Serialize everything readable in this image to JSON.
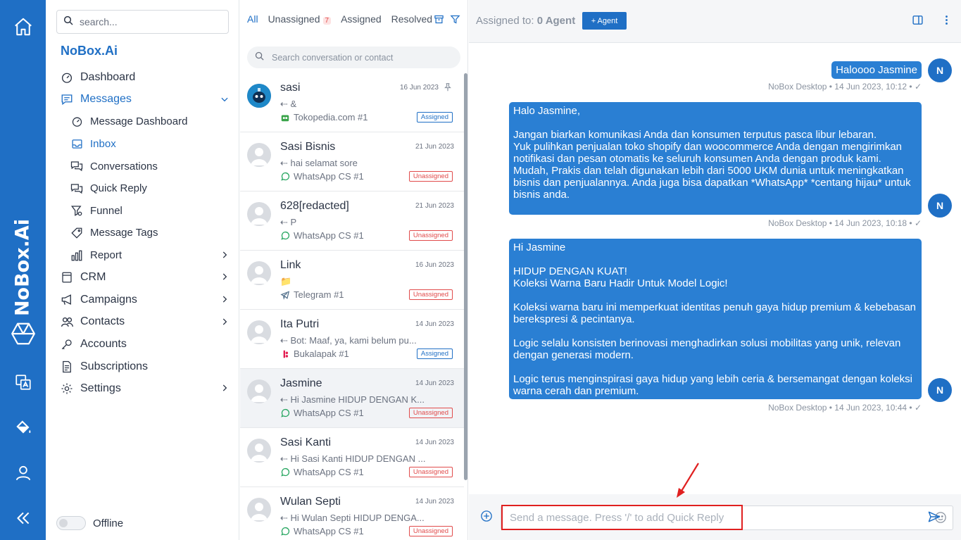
{
  "rail": {
    "brand_vertical": "NoBox.Ai",
    "icons": [
      "home-icon",
      "translate-icon",
      "paint-bucket-icon",
      "user-icon",
      "collapse-icon"
    ]
  },
  "sidebar": {
    "search_placeholder": "search...",
    "brand": "NoBox.Ai",
    "items": [
      {
        "label": "Dashboard",
        "icon": "gauge-icon"
      },
      {
        "label": "Messages",
        "icon": "message-icon",
        "active": true,
        "expanded": true
      },
      {
        "label": "Message Dashboard",
        "icon": "gauge-icon",
        "sub": true
      },
      {
        "label": "Inbox",
        "icon": "inbox-icon",
        "sub": true,
        "active": true
      },
      {
        "label": "Conversations",
        "icon": "conversations-icon",
        "sub": true
      },
      {
        "label": "Quick Reply",
        "icon": "quick-reply-icon",
        "sub": true
      },
      {
        "label": "Funnel",
        "icon": "funnel-icon",
        "sub": true
      },
      {
        "label": "Message Tags",
        "icon": "tag-icon",
        "sub": true
      },
      {
        "label": "Report",
        "icon": "report-icon",
        "sub": true,
        "has_children": true
      },
      {
        "label": "CRM",
        "icon": "crm-icon",
        "has_children": true
      },
      {
        "label": "Campaigns",
        "icon": "megaphone-icon",
        "has_children": true
      },
      {
        "label": "Contacts",
        "icon": "contacts-icon",
        "has_children": true
      },
      {
        "label": "Accounts",
        "icon": "key-icon"
      },
      {
        "label": "Subscriptions",
        "icon": "document-icon"
      },
      {
        "label": "Settings",
        "icon": "gear-icon",
        "has_children": true
      }
    ],
    "status_label": "Offline"
  },
  "list": {
    "tabs": [
      {
        "label": "All",
        "active": true
      },
      {
        "label": "Unassigned",
        "badge": "7"
      },
      {
        "label": "Assigned"
      },
      {
        "label": "Resolved"
      }
    ],
    "search_placeholder": "Search conversation or contact",
    "conversations": [
      {
        "name": "sasi",
        "date": "16 Jun 2023",
        "preview": "&",
        "source": "Tokopedia.com #1",
        "source_icon": "tokopedia-icon",
        "status": "Assigned",
        "pinned": true,
        "avatar": "robot"
      },
      {
        "name": "Sasi Bisnis",
        "date": "21 Jun 2023",
        "preview": "hai selamat sore",
        "source": "WhatsApp CS #1",
        "source_icon": "whatsapp-icon",
        "status": "Unassigned"
      },
      {
        "name": "628[redacted]",
        "date": "21 Jun 2023",
        "preview": "P",
        "source": "WhatsApp CS #1",
        "source_icon": "whatsapp-icon",
        "status": "Unassigned"
      },
      {
        "name": "Link",
        "date": "16 Jun 2023",
        "preview": "📁",
        "source": "Telegram #1",
        "source_icon": "telegram-icon",
        "status": "Unassigned"
      },
      {
        "name": "Ita Putri",
        "date": "14 Jun 2023",
        "preview": "Bot: Maaf, ya, kami belum pu...",
        "source": "Bukalapak #1",
        "source_icon": "bukalapak-icon",
        "status": "Assigned"
      },
      {
        "name": "Jasmine",
        "date": "14 Jun 2023",
        "preview": "Hi Jasmine HIDUP DENGAN K...",
        "source": "WhatsApp CS #1",
        "source_icon": "whatsapp-icon",
        "status": "Unassigned",
        "selected": true
      },
      {
        "name": "Sasi Kanti",
        "date": "14 Jun 2023",
        "preview": "Hi Sasi Kanti HIDUP DENGAN ...",
        "source": "WhatsApp CS #1",
        "source_icon": "whatsapp-icon",
        "status": "Unassigned"
      },
      {
        "name": "Wulan Septi",
        "date": "14 Jun 2023",
        "preview": "Hi Wulan Septi HIDUP DENGA...",
        "source": "WhatsApp CS #1",
        "source_icon": "whatsapp-icon",
        "status": "Unassigned"
      }
    ]
  },
  "chat": {
    "assigned_prefix": "Assigned to:",
    "assigned_value": "0 Agent",
    "agent_button": "+ Agent",
    "messages": [
      {
        "text": "Haloooo Jasmine",
        "meta": "NoBox Desktop • 14 Jun 2023, 10:12 •",
        "avatar": "N"
      },
      {
        "text": "Halo Jasmine,\n\nJangan biarkan komunikasi Anda dan konsumen terputus pasca libur lebaran.\nYuk pulihkan penjualan toko shopify dan woocommerce Anda dengan mengirimkan notifikasi dan pesan otomatis ke seluruh konsumen Anda dengan produk kami.\nMudah, Prakis dan telah digunakan lebih dari 5000 UKM dunia untuk meningkatkan bisnis dan penjualannya. Anda juga bisa dapatkan *WhatsApp* *centang hijau* untuk bisnis anda.",
        "meta": "NoBox Desktop • 14 Jun 2023, 10:18 •",
        "avatar": "N"
      },
      {
        "text": "Hi Jasmine\n\nHIDUP DENGAN KUAT!\nKoleksi Warna Baru Hadir Untuk Model Logic!\n\nKoleksi warna baru ini memperkuat identitas penuh gaya hidup premium & kebebasan berekspresi & pecintanya.\n\nLogic selalu konsisten berinovasi menghadirkan solusi mobilitas yang unik, relevan dengan generasi modern.\n\nLogic terus menginspirasi gaya hidup yang lebih ceria & bersemangat dengan koleksi warna cerah dan premium.",
        "meta": "NoBox Desktop • 14 Jun 2023, 10:44 •",
        "avatar": "N"
      }
    ],
    "composer_placeholder": "Send a message. Press '/' to add Quick Reply"
  }
}
